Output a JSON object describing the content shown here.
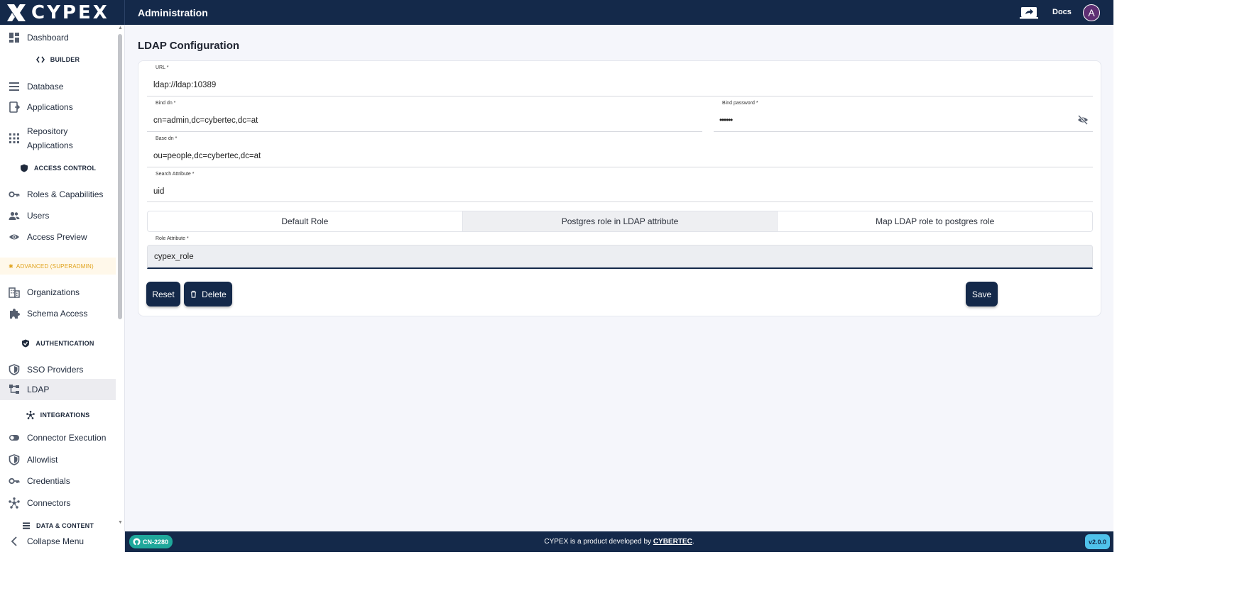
{
  "header": {
    "brand": "CYPEX",
    "title": "Administration",
    "docs_label": "Docs",
    "avatar_initial": "A"
  },
  "sidebar": {
    "items": [
      {
        "label": "Dashboard",
        "icon": "dashboard-icon"
      },
      {
        "label": "Database",
        "icon": "list-icon"
      },
      {
        "label": "Applications",
        "icon": "app-icon"
      },
      {
        "label": "Repository Applications",
        "icon": "grid-icon"
      },
      {
        "label": "Roles & Capabilities",
        "icon": "key-icon"
      },
      {
        "label": "Users",
        "icon": "users-icon"
      },
      {
        "label": "Access Preview",
        "icon": "eye-icon"
      },
      {
        "label": "Organizations",
        "icon": "building-icon"
      },
      {
        "label": "Schema Access",
        "icon": "puzzle-icon"
      },
      {
        "label": "SSO Providers",
        "icon": "shield-icon"
      },
      {
        "label": "LDAP",
        "icon": "ldap-icon"
      },
      {
        "label": "Connector Execution",
        "icon": "toggle-icon"
      },
      {
        "label": "Allowlist",
        "icon": "shield-icon"
      },
      {
        "label": "Credentials",
        "icon": "key-icon"
      },
      {
        "label": "Connectors",
        "icon": "hub-icon"
      }
    ],
    "sections": {
      "builder": "BUILDER",
      "access_control": "ACCESS CONTROL",
      "advanced": "ADVANCED (SUPERADMIN)",
      "authentication": "AUTHENTICATION",
      "integrations": "INTEGRATIONS",
      "data_content": "DATA & CONTENT"
    },
    "active_item": "LDAP",
    "collapse_label": "Collapse Menu"
  },
  "main": {
    "page_title": "LDAP Configuration",
    "fields": {
      "url": {
        "label": "URL *",
        "value": "ldap://ldap:10389"
      },
      "bind_dn": {
        "label": "Bind dn *",
        "value": "cn=admin,dc=cybertec,dc=at"
      },
      "bind_password": {
        "label": "Bind password *",
        "value": "••••••"
      },
      "base_dn": {
        "label": "Base dn *",
        "value": "ou=people,dc=cybertec,dc=at"
      },
      "search_attribute": {
        "label": "Search Attribute *",
        "value": "uid"
      },
      "role_attribute": {
        "label": "Role Attribute *",
        "value": "cypex_role"
      }
    },
    "role_tabs": [
      {
        "label": "Default Role",
        "selected": false
      },
      {
        "label": "Postgres role in LDAP attribute",
        "selected": true
      },
      {
        "label": "Map LDAP role to postgres role",
        "selected": false
      }
    ],
    "buttons": {
      "reset": "Reset",
      "delete": "Delete",
      "save": "Save"
    }
  },
  "footer": {
    "issue_badge": "CN-2280",
    "text_prefix": "CYPEX is a product developed by ",
    "brand_link": "CYBERTEC",
    "text_suffix": ".",
    "version": "v2.0.0"
  },
  "colors": {
    "navy": "#14294a",
    "teal_badge": "#1fa89b",
    "version_badge": "#4fc1ea",
    "advanced_accent": "#e0a21b"
  }
}
